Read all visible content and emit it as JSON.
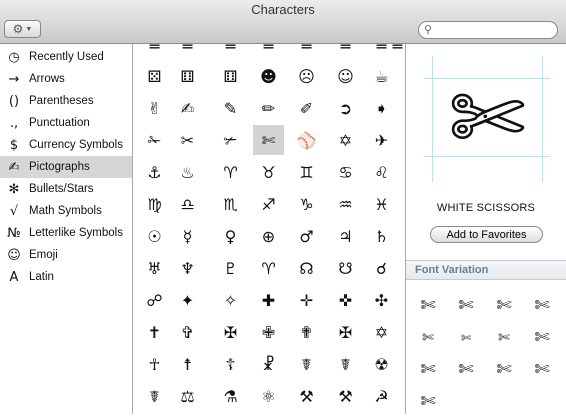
{
  "window": {
    "title": "Characters"
  },
  "toolbar": {
    "gear_icon": "gear-icon",
    "search_placeholder": "",
    "search_value": ""
  },
  "categories": [
    {
      "label": "Recently Used",
      "icon": "◷",
      "icon_name": "clock-icon",
      "selected": false
    },
    {
      "label": "Arrows",
      "icon": "→",
      "icon_name": "arrow-icon",
      "selected": false
    },
    {
      "label": "Parentheses",
      "icon": "()",
      "icon_name": "parentheses-icon",
      "selected": false
    },
    {
      "label": "Punctuation",
      "icon": ".,",
      "icon_name": "punctuation-icon",
      "selected": false
    },
    {
      "label": "Currency Symbols",
      "icon": "$",
      "icon_name": "dollar-icon",
      "selected": false
    },
    {
      "label": "Pictographs",
      "icon": "✍",
      "icon_name": "pictograph-icon",
      "selected": true
    },
    {
      "label": "Bullets/Stars",
      "icon": "✻",
      "icon_name": "star-icon",
      "selected": false
    },
    {
      "label": "Math Symbols",
      "icon": "√",
      "icon_name": "square-root-icon",
      "selected": false
    },
    {
      "label": "Letterlike Symbols",
      "icon": "№",
      "icon_name": "numero-icon",
      "selected": false
    },
    {
      "label": "Emoji",
      "icon": "☺",
      "icon_name": "smiley-icon",
      "selected": false
    },
    {
      "label": "Latin",
      "icon": "A",
      "icon_name": "latin-letter-icon",
      "selected": false
    }
  ],
  "grid_rows": [
    [
      "═",
      "═",
      "═",
      "═",
      "═",
      "═",
      "═",
      "═"
    ],
    [
      "⚄",
      "⚅",
      "⚅",
      "☻",
      "☹",
      "☺",
      "☕",
      ""
    ],
    [
      "✌",
      "✍",
      "✎",
      "✏",
      "✐",
      "➲",
      "➧",
      ""
    ],
    [
      "✁",
      "✂",
      "✃",
      "✄",
      "⚾",
      "✡",
      "✈",
      ""
    ],
    [
      "⚓",
      "♨",
      "♈",
      "♉",
      "♊",
      "♋",
      "♌",
      ""
    ],
    [
      "♍",
      "♎",
      "♏",
      "♐",
      "♑",
      "♒",
      "♓",
      ""
    ],
    [
      "☉",
      "☿",
      "♀",
      "⊕",
      "♂",
      "♃",
      "♄",
      ""
    ],
    [
      "♅",
      "♆",
      "♇",
      "♈",
      "☊",
      "☋",
      "☌",
      ""
    ],
    [
      "☍",
      "✦",
      "✧",
      "✚",
      "✛",
      "✜",
      "✣",
      ""
    ],
    [
      "✝",
      "✞",
      "✠",
      "✙",
      "✟",
      "✠",
      "✡",
      ""
    ],
    [
      "☥",
      "☨",
      "☦",
      "☧",
      "☤",
      "☤",
      "☢",
      ""
    ],
    [
      "☤",
      "⚖",
      "⚗",
      "⚛",
      "⚒",
      "⚒",
      "☭",
      ""
    ]
  ],
  "selected_character": {
    "glyph": "✄",
    "name": "WHITE SCISSORS"
  },
  "detail": {
    "add_favorites_label": "Add to Favorites",
    "font_variation_header": "Font Variation",
    "variations": [
      "✄",
      "✄",
      "✄",
      "✄",
      "✄",
      "✄",
      "✄",
      "✄",
      "✄",
      "✄",
      "✄",
      "✄",
      "✄"
    ]
  }
}
